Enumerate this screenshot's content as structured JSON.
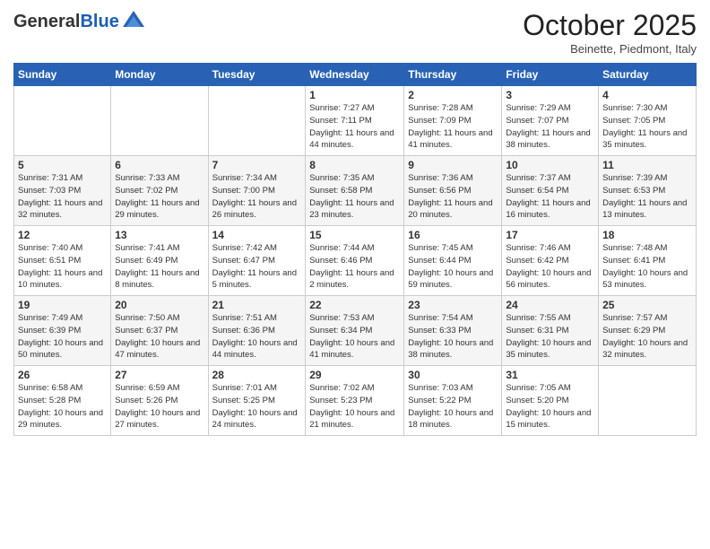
{
  "logo": {
    "general": "General",
    "blue": "Blue"
  },
  "header": {
    "month": "October 2025",
    "location": "Beinette, Piedmont, Italy"
  },
  "weekdays": [
    "Sunday",
    "Monday",
    "Tuesday",
    "Wednesday",
    "Thursday",
    "Friday",
    "Saturday"
  ],
  "weeks": [
    [
      {
        "day": "",
        "info": ""
      },
      {
        "day": "",
        "info": ""
      },
      {
        "day": "",
        "info": ""
      },
      {
        "day": "1",
        "info": "Sunrise: 7:27 AM\nSunset: 7:11 PM\nDaylight: 11 hours and 44 minutes."
      },
      {
        "day": "2",
        "info": "Sunrise: 7:28 AM\nSunset: 7:09 PM\nDaylight: 11 hours and 41 minutes."
      },
      {
        "day": "3",
        "info": "Sunrise: 7:29 AM\nSunset: 7:07 PM\nDaylight: 11 hours and 38 minutes."
      },
      {
        "day": "4",
        "info": "Sunrise: 7:30 AM\nSunset: 7:05 PM\nDaylight: 11 hours and 35 minutes."
      }
    ],
    [
      {
        "day": "5",
        "info": "Sunrise: 7:31 AM\nSunset: 7:03 PM\nDaylight: 11 hours and 32 minutes."
      },
      {
        "day": "6",
        "info": "Sunrise: 7:33 AM\nSunset: 7:02 PM\nDaylight: 11 hours and 29 minutes."
      },
      {
        "day": "7",
        "info": "Sunrise: 7:34 AM\nSunset: 7:00 PM\nDaylight: 11 hours and 26 minutes."
      },
      {
        "day": "8",
        "info": "Sunrise: 7:35 AM\nSunset: 6:58 PM\nDaylight: 11 hours and 23 minutes."
      },
      {
        "day": "9",
        "info": "Sunrise: 7:36 AM\nSunset: 6:56 PM\nDaylight: 11 hours and 20 minutes."
      },
      {
        "day": "10",
        "info": "Sunrise: 7:37 AM\nSunset: 6:54 PM\nDaylight: 11 hours and 16 minutes."
      },
      {
        "day": "11",
        "info": "Sunrise: 7:39 AM\nSunset: 6:53 PM\nDaylight: 11 hours and 13 minutes."
      }
    ],
    [
      {
        "day": "12",
        "info": "Sunrise: 7:40 AM\nSunset: 6:51 PM\nDaylight: 11 hours and 10 minutes."
      },
      {
        "day": "13",
        "info": "Sunrise: 7:41 AM\nSunset: 6:49 PM\nDaylight: 11 hours and 8 minutes."
      },
      {
        "day": "14",
        "info": "Sunrise: 7:42 AM\nSunset: 6:47 PM\nDaylight: 11 hours and 5 minutes."
      },
      {
        "day": "15",
        "info": "Sunrise: 7:44 AM\nSunset: 6:46 PM\nDaylight: 11 hours and 2 minutes."
      },
      {
        "day": "16",
        "info": "Sunrise: 7:45 AM\nSunset: 6:44 PM\nDaylight: 10 hours and 59 minutes."
      },
      {
        "day": "17",
        "info": "Sunrise: 7:46 AM\nSunset: 6:42 PM\nDaylight: 10 hours and 56 minutes."
      },
      {
        "day": "18",
        "info": "Sunrise: 7:48 AM\nSunset: 6:41 PM\nDaylight: 10 hours and 53 minutes."
      }
    ],
    [
      {
        "day": "19",
        "info": "Sunrise: 7:49 AM\nSunset: 6:39 PM\nDaylight: 10 hours and 50 minutes."
      },
      {
        "day": "20",
        "info": "Sunrise: 7:50 AM\nSunset: 6:37 PM\nDaylight: 10 hours and 47 minutes."
      },
      {
        "day": "21",
        "info": "Sunrise: 7:51 AM\nSunset: 6:36 PM\nDaylight: 10 hours and 44 minutes."
      },
      {
        "day": "22",
        "info": "Sunrise: 7:53 AM\nSunset: 6:34 PM\nDaylight: 10 hours and 41 minutes."
      },
      {
        "day": "23",
        "info": "Sunrise: 7:54 AM\nSunset: 6:33 PM\nDaylight: 10 hours and 38 minutes."
      },
      {
        "day": "24",
        "info": "Sunrise: 7:55 AM\nSunset: 6:31 PM\nDaylight: 10 hours and 35 minutes."
      },
      {
        "day": "25",
        "info": "Sunrise: 7:57 AM\nSunset: 6:29 PM\nDaylight: 10 hours and 32 minutes."
      }
    ],
    [
      {
        "day": "26",
        "info": "Sunrise: 6:58 AM\nSunset: 5:28 PM\nDaylight: 10 hours and 29 minutes."
      },
      {
        "day": "27",
        "info": "Sunrise: 6:59 AM\nSunset: 5:26 PM\nDaylight: 10 hours and 27 minutes."
      },
      {
        "day": "28",
        "info": "Sunrise: 7:01 AM\nSunset: 5:25 PM\nDaylight: 10 hours and 24 minutes."
      },
      {
        "day": "29",
        "info": "Sunrise: 7:02 AM\nSunset: 5:23 PM\nDaylight: 10 hours and 21 minutes."
      },
      {
        "day": "30",
        "info": "Sunrise: 7:03 AM\nSunset: 5:22 PM\nDaylight: 10 hours and 18 minutes."
      },
      {
        "day": "31",
        "info": "Sunrise: 7:05 AM\nSunset: 5:20 PM\nDaylight: 10 hours and 15 minutes."
      },
      {
        "day": "",
        "info": ""
      }
    ]
  ]
}
